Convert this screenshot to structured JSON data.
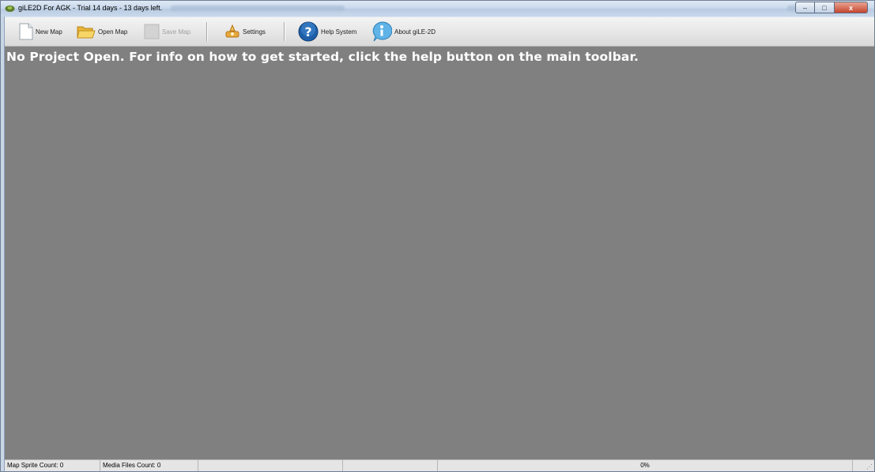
{
  "window": {
    "title": "giLE2D For AGK - Trial 14 days - 13 days left.",
    "controls": {
      "minimize": "–",
      "maximize": "□",
      "close": "x"
    }
  },
  "toolbar": {
    "new_map": {
      "label": "New Map",
      "icon": "document-icon"
    },
    "open_map": {
      "label": "Open Map",
      "icon": "folder-open-icon"
    },
    "save_map": {
      "label": "Save Map",
      "icon": "save-icon",
      "enabled": false
    },
    "settings": {
      "label": "Settings",
      "icon": "settings-icon"
    },
    "help_system": {
      "label": "Help System",
      "icon": "help-icon"
    },
    "about": {
      "label": "About giLE-2D",
      "icon": "info-icon"
    }
  },
  "main": {
    "message": "No Project Open. For info on how to get started, click the help button on the main toolbar.",
    "background": "#808080"
  },
  "statusbar": {
    "sprite_count": "Map Sprite Count: 0",
    "media_count": "Media Files Count: 0",
    "progress": "0%"
  }
}
